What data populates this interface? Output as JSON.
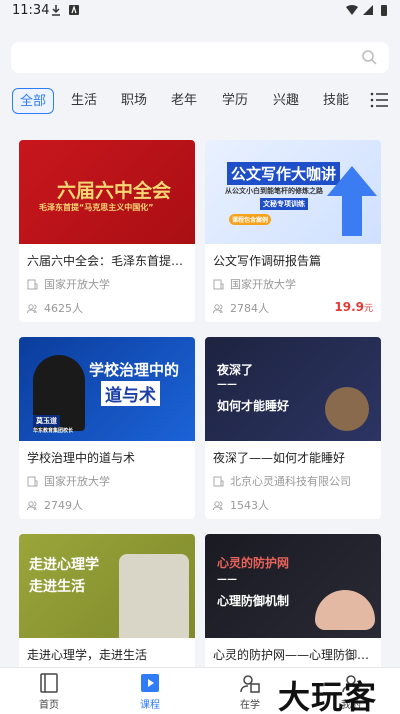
{
  "status": {
    "time": "11:34"
  },
  "search": {
    "placeholder": ""
  },
  "tabs": [
    {
      "label": "全部",
      "active": true
    },
    {
      "label": "生活"
    },
    {
      "label": "职场"
    },
    {
      "label": "老年"
    },
    {
      "label": "学历"
    },
    {
      "label": "兴趣"
    },
    {
      "label": "技能"
    }
  ],
  "courses": [
    {
      "title": "六届六中全会：毛泽东首提“...",
      "org": "国家开放大学",
      "count": "4625人",
      "image_text": {
        "main": "六届六中全会",
        "sub": "毛泽东首提“马克思主义中国化”"
      }
    },
    {
      "title": "公文写作调研报告篇",
      "org": "国家开放大学",
      "count": "2784人",
      "price": "19.9",
      "price_unit": "元",
      "image_text": {
        "main": "公文写作大咖讲",
        "sub": "从公文小白到能笔杆的修炼之路",
        "sub2": "文秘专项训练",
        "badge": "课程包含案例"
      }
    },
    {
      "title": "学校治理中的道与术",
      "org": "国家开放大学",
      "count": "2749人",
      "image_text": {
        "main": "学校治理中的",
        "main2": "道与术",
        "name": "莫玉道",
        "caption": "华东教育集团校长"
      }
    },
    {
      "title": "夜深了——如何才能睡好",
      "org": "北京心灵通科技有限公司",
      "count": "1543人",
      "image_text": {
        "main": "夜深了",
        "dash": "——",
        "main2": "如何才能睡好"
      }
    },
    {
      "title": "走进心理学，走进生活",
      "image_text": {
        "main": "走进心理学",
        "main2": "走进生活"
      }
    },
    {
      "title": "心灵的防护网——心理防御机制",
      "image_text": {
        "main": "心灵的防护网",
        "dash": "——",
        "main2": "心理防御机制"
      }
    }
  ],
  "nav": [
    {
      "label": "首页",
      "icon": "book-icon"
    },
    {
      "label": "课程",
      "icon": "play-icon",
      "active": true
    },
    {
      "label": "在学",
      "icon": "study-icon"
    },
    {
      "label": "我的",
      "icon": "profile-icon"
    }
  ],
  "watermark": "大玩客",
  "colors": {
    "accent": "#2f7cf6",
    "price": "#e53935"
  }
}
